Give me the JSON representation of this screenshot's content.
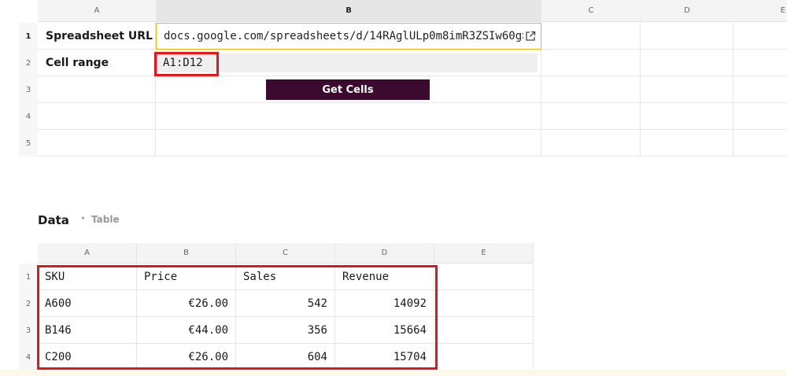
{
  "top_sheet": {
    "columns": [
      "A",
      "B",
      "C",
      "D",
      "E"
    ],
    "rows": [
      "1",
      "2",
      "3",
      "4",
      "5"
    ],
    "url_label": "Spreadsheet URL",
    "url_value": "docs.google.com/spreadsheets/d/14RAglULp0m8imR3ZSIw60g>",
    "range_label": "Cell range",
    "range_value": "A1:D12",
    "button_label": "Get Cells"
  },
  "data_section": {
    "title": "Data",
    "separator": "•",
    "subtitle": "Table",
    "columns": [
      "A",
      "B",
      "C",
      "D",
      "E"
    ],
    "rows": [
      "1",
      "2",
      "3",
      "4"
    ],
    "table": [
      [
        "SKU",
        "Price",
        "Sales",
        "Revenue",
        ""
      ],
      [
        "A600",
        "€26.00",
        "542",
        "14092",
        ""
      ],
      [
        "B146",
        "€44.00",
        "356",
        "15664",
        ""
      ],
      [
        "C200",
        "€26.00",
        "604",
        "15704",
        ""
      ]
    ]
  },
  "colors": {
    "accent_button": "#3b0a2e",
    "highlight_red": "#e8141b",
    "selected_border": "#f2b705"
  }
}
